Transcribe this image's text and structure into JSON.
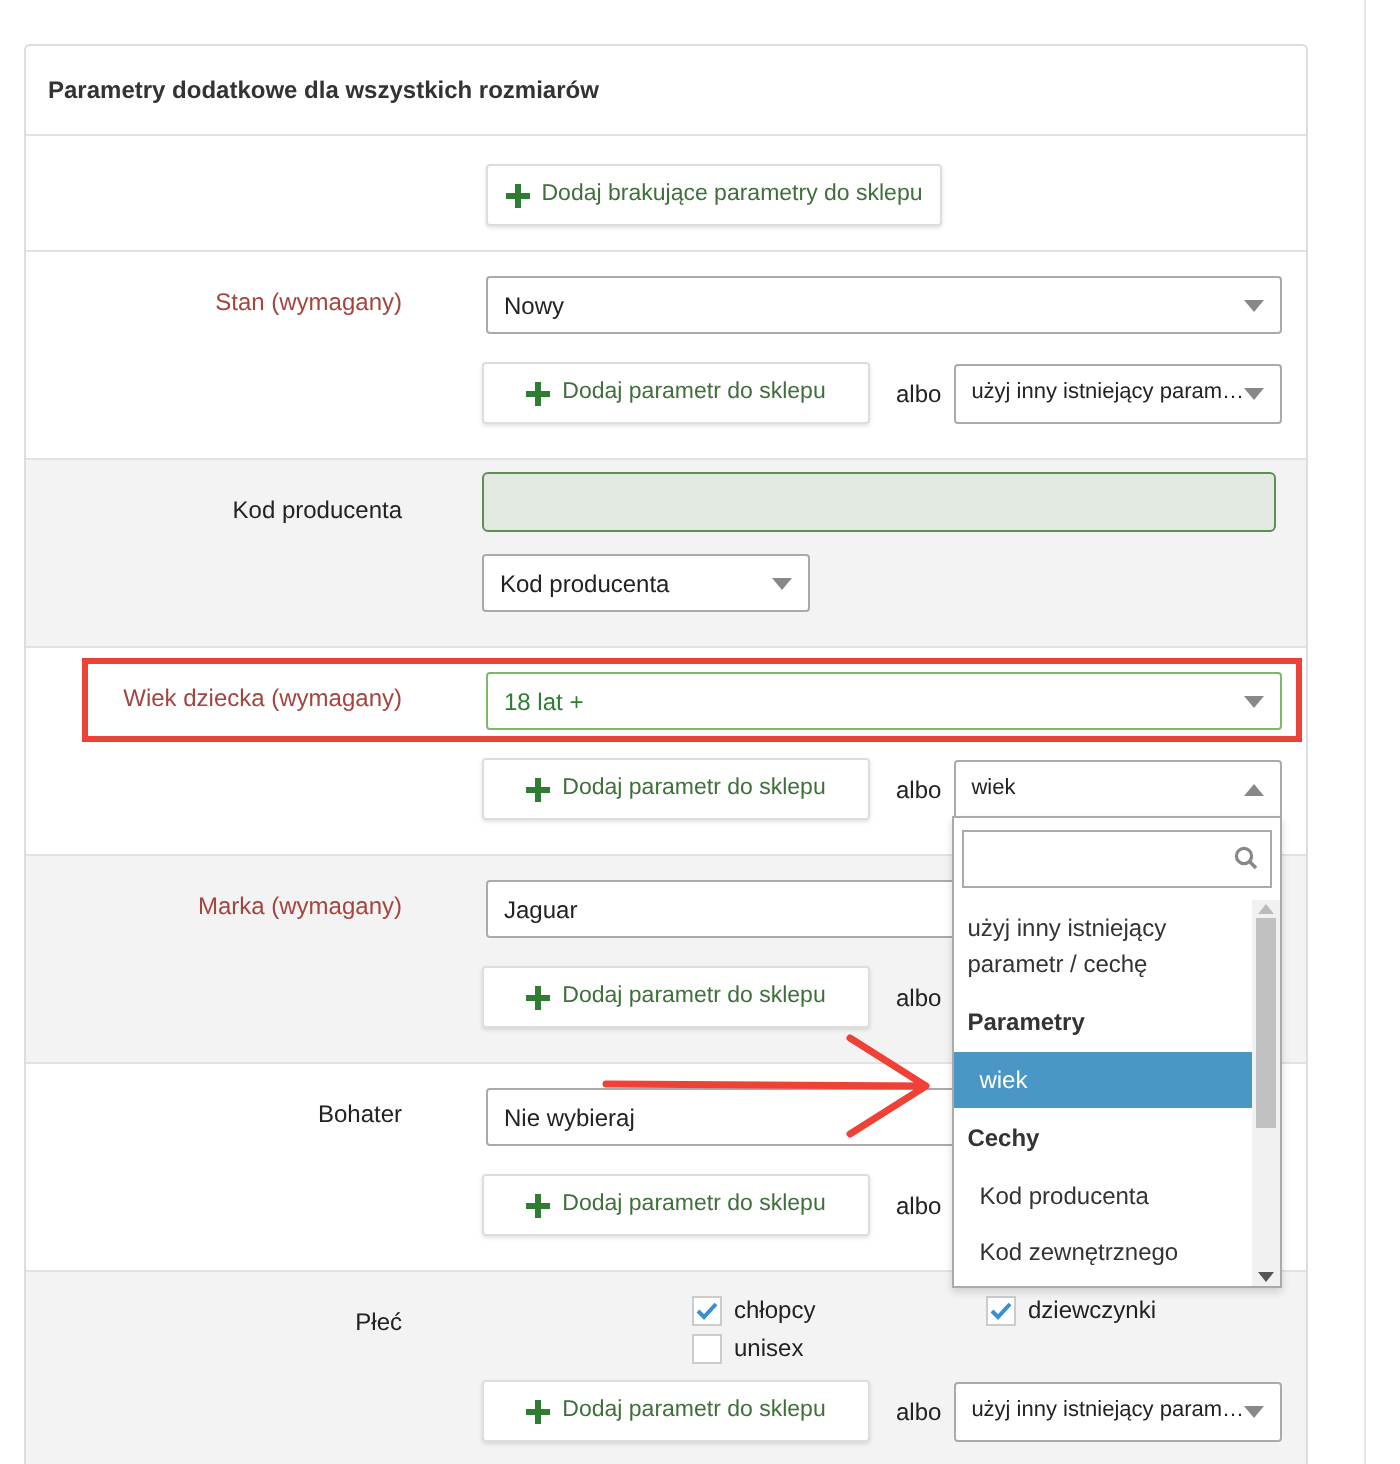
{
  "panel": {
    "title": "Parametry dodatkowe dla wszystkich rozmiarów"
  },
  "pointer_arrow": true,
  "rows": [
    {
      "kind": "action",
      "button": "Dodaj brakujące parametry do sklepu"
    },
    {
      "kind": "select",
      "label": "Stan (wymagany)",
      "required": true,
      "highlighted": false,
      "value": "Nowy",
      "add_button": "Dodaj parametr do sklepu",
      "albo": "albo",
      "other_select": {
        "value": "użyj inny istniejący param…",
        "open": false
      }
    },
    {
      "kind": "input",
      "label": "Kod producenta",
      "required": false,
      "select_value": "Kod producenta"
    },
    {
      "kind": "select",
      "label": "Wiek dziecka (wymagany)",
      "required": true,
      "highlighted": true,
      "value": "18 lat +",
      "valid": true,
      "add_button": "Dodaj parametr do sklepu",
      "albo": "albo",
      "other_select": {
        "value": "wiek",
        "open": true,
        "dropdown": [
          {
            "kind": "option",
            "label": "użyj inny istniejący parametr / cechę",
            "selected": false
          },
          {
            "kind": "group",
            "label": "Parametry"
          },
          {
            "kind": "option",
            "label": "wiek",
            "selected": true
          },
          {
            "kind": "group",
            "label": "Cechy"
          },
          {
            "kind": "option",
            "label": "Kod producenta",
            "selected": false
          },
          {
            "kind": "option",
            "label": "Kod zewnętrznego",
            "selected": false
          }
        ]
      }
    },
    {
      "kind": "select",
      "label": "Marka (wymagany)",
      "required": true,
      "highlighted": false,
      "value": "Jaguar",
      "add_button": "Dodaj parametr do sklepu",
      "albo": "albo"
    },
    {
      "kind": "select",
      "label": "Bohater",
      "required": false,
      "highlighted": false,
      "value": "Nie wybieraj",
      "add_button": "Dodaj parametr do sklepu",
      "albo": "albo"
    },
    {
      "kind": "checkboxes",
      "label": "Płeć",
      "required": false,
      "options": [
        {
          "label": "chłopcy",
          "checked": true
        },
        {
          "label": "dziewczynki",
          "checked": true
        },
        {
          "label": "unisex",
          "checked": false
        }
      ],
      "add_button": "Dodaj parametr do sklepu",
      "albo": "albo",
      "other_select": {
        "value": "użyj inny istniejący param…",
        "open": false
      }
    }
  ]
}
